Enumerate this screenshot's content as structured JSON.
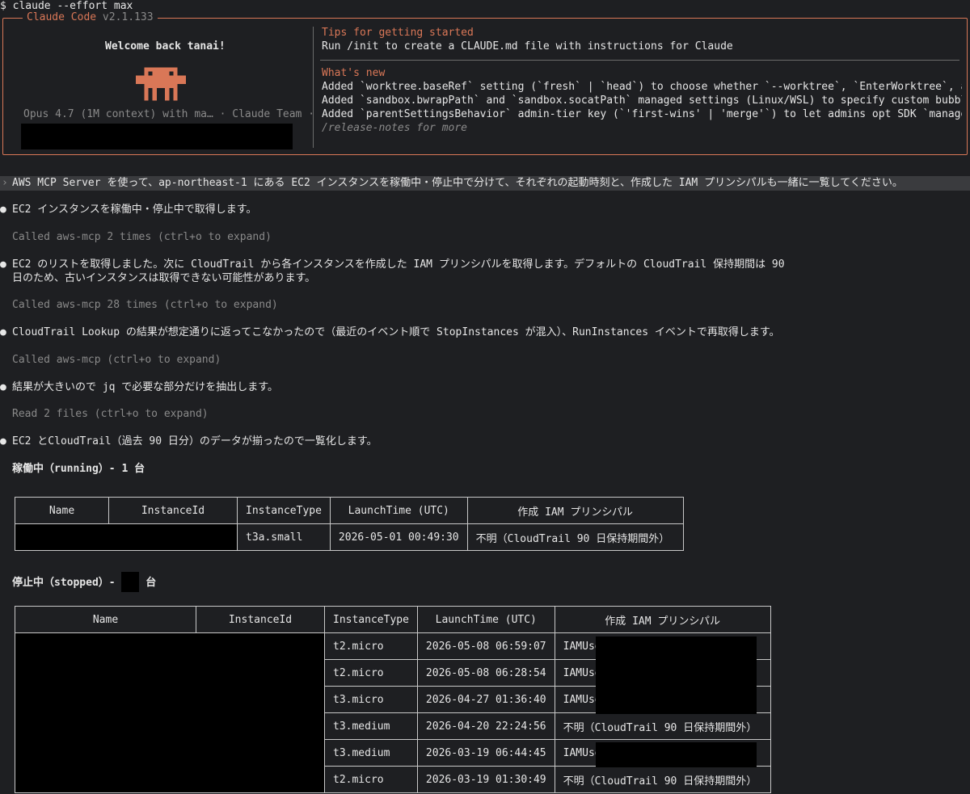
{
  "shell": {
    "command": "$ claude --effort max"
  },
  "welcome": {
    "app_name": "Claude Code",
    "version": "v2.1.133",
    "greeting": "Welcome back tanai!",
    "model_line": "Opus 4.7 (1M context) with ma… · Claude Team ·",
    "tips_title": "Tips for getting started",
    "tips_text": "Run /init to create a CLAUDE.md file with instructions for Claude",
    "whats_new_title": "What's new",
    "news": [
      "Added `worktree.baseRef` setting (`fresh` | `head`) to choose whether `--worktree`, `EnterWorktree`, and age…",
      "Added `sandbox.bwrapPath` and `sandbox.socatPath` managed settings (Linux/WSL) to specify custom bubblewrap …",
      "Added `parentSettingsBehavior` admin-tier key (`'first-wins' | 'merge'`) to let admins opt SDK `managedSetti…"
    ],
    "release_notes": "/release-notes for more",
    "accent_color": "#d97757"
  },
  "prompt": {
    "marker": "›",
    "text": "AWS MCP Server を使って、ap-northeast-1 にある EC2 インスタンスを稼働中・停止中で分けて、それぞれの起動時刻と、作成した IAM プリンシパルも一緒に一覧してください。"
  },
  "transcript": {
    "bullet": "●",
    "m1": "EC2 インスタンスを稼働中・停止中で取得します。",
    "t1": "Called aws-mcp 2 times (ctrl+o to expand)",
    "m2a": "EC2 のリストを取得しました。次に CloudTrail から各インスタンスを作成した IAM プリンシパルを取得します。デフォルトの CloudTrail 保持期間は 90",
    "m2b": "日のため、古いインスタンスは取得できない可能性があります。",
    "t2": "Called aws-mcp 28 times (ctrl+o to expand)",
    "m3": "CloudTrail Lookup の結果が想定通りに返ってこなかったので（最近のイベント順で StopInstances が混入）、RunInstances イベントで再取得します。",
    "t3": "Called aws-mcp (ctrl+o to expand)",
    "m4": "結果が大きいので jq で必要な部分だけを抽出します。",
    "t4": "Read 2 files (ctrl+o to expand)",
    "m5": "EC2 とCloudTrail（過去 90 日分）のデータが揃ったので一覧化します。"
  },
  "running": {
    "heading": "稼働中（running）- 1 台",
    "headers": [
      "Name",
      "InstanceId",
      "InstanceType",
      "LaunchTime (UTC)",
      "作成 IAM プリンシパル"
    ],
    "rows": [
      {
        "type": "t3a.small",
        "launch": "2026-05-01 00:49:30",
        "principal": "不明（CloudTrail 90 日保持期間外）"
      }
    ]
  },
  "stopped": {
    "heading_prefix": "停止中（stopped）- ",
    "heading_suffix": " 台",
    "headers": [
      "Name",
      "InstanceId",
      "InstanceType",
      "LaunchTime (UTC)",
      "作成 IAM プリンシパル"
    ],
    "rows": [
      {
        "type": "t2.micro",
        "launch": "2026-05-08 06:59:07",
        "principal": "IAMUser:"
      },
      {
        "type": "t2.micro",
        "launch": "2026-05-08 06:28:54",
        "principal": "IAMUser:"
      },
      {
        "type": "t3.micro",
        "launch": "2026-04-27 01:36:40",
        "principal": "IAMUser:"
      },
      {
        "type": "t3.medium",
        "launch": "2026-04-20 22:24:56",
        "principal": "不明（CloudTrail 90 日保持期間外）"
      },
      {
        "type": "t3.medium",
        "launch": "2026-03-19 06:44:45",
        "principal": "IAMUser:"
      },
      {
        "type": "t2.micro",
        "launch": "2026-03-19 01:30:49",
        "principal": "不明（CloudTrail 90 日保持期間外）"
      }
    ]
  }
}
